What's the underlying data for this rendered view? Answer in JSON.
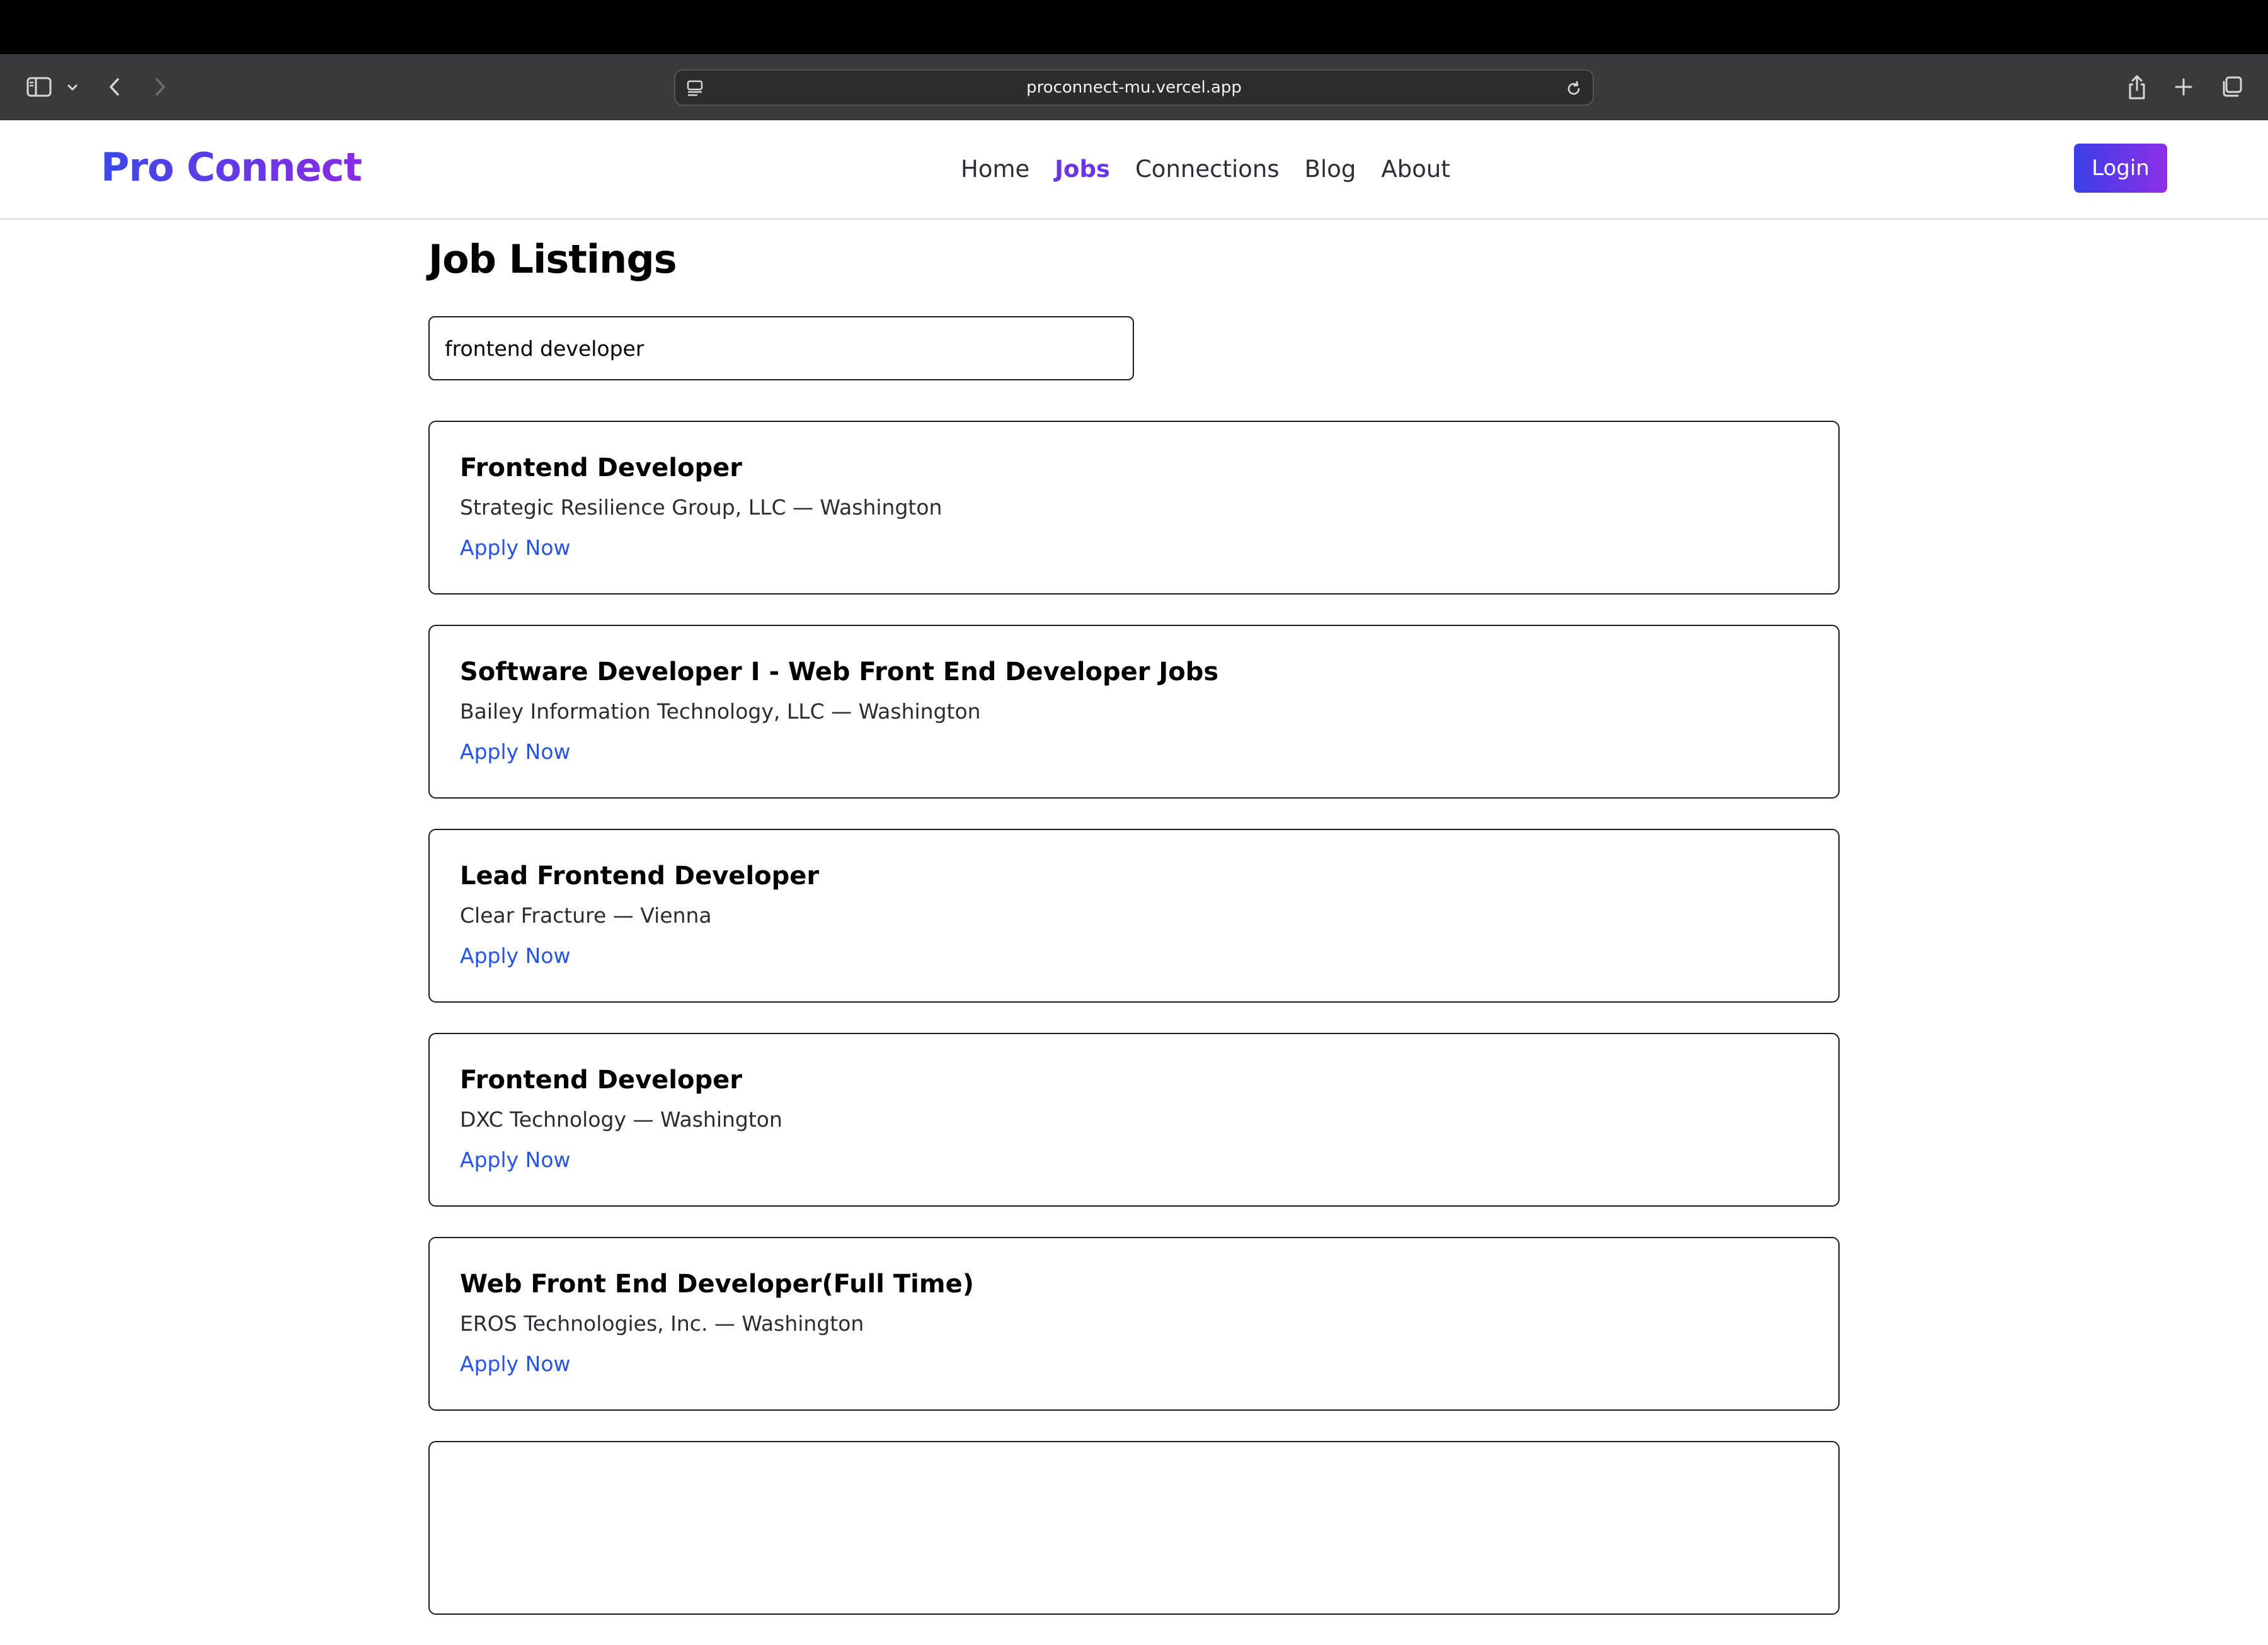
{
  "browser": {
    "url": "proconnect-mu.vercel.app",
    "icons": {
      "sidebar": "sidebar-icon",
      "dropdown": "chevron-down-icon",
      "back": "chevron-left-icon",
      "forward": "chevron-right-icon",
      "site_settings": "site-settings-icon",
      "reload": "reload-icon",
      "share": "share-icon",
      "new_tab": "plus-icon",
      "tabs": "tab-overview-icon"
    }
  },
  "header": {
    "logo": "Pro Connect",
    "nav": [
      "Home",
      "Jobs",
      "Connections",
      "Blog",
      "About"
    ],
    "active_nav": "Jobs",
    "login_label": "Login"
  },
  "main": {
    "title": "Job Listings",
    "search_value": "frontend developer",
    "jobs": [
      {
        "title": "Frontend Developer",
        "meta": "Strategic Resilience Group, LLC — Washington",
        "apply_label": "Apply Now"
      },
      {
        "title": "Software Developer I - Web Front End Developer Jobs",
        "meta": "Bailey Information Technology, LLC — Washington",
        "apply_label": "Apply Now"
      },
      {
        "title": "Lead Frontend Developer",
        "meta": "Clear Fracture — Vienna",
        "apply_label": "Apply Now"
      },
      {
        "title": "Frontend Developer",
        "meta": "DXC Technology — Washington",
        "apply_label": "Apply Now"
      },
      {
        "title": "Web Front End Developer(Full Time)",
        "meta": "EROS Technologies, Inc. — Washington",
        "apply_label": "Apply Now"
      }
    ]
  },
  "colors": {
    "brand_start": "#3b49e8",
    "brand_end": "#8a2be2",
    "active_nav": "#6a35e6",
    "link": "#2554e6",
    "browser_bar": "#3a3a3c"
  }
}
